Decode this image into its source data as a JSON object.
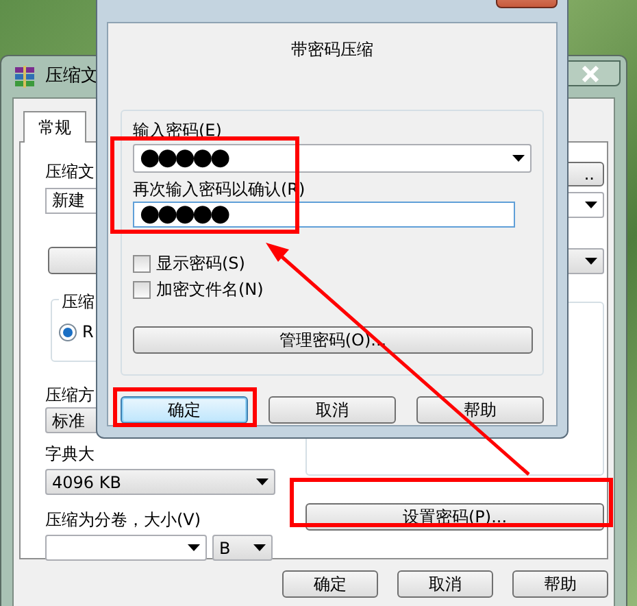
{
  "background_window": {
    "title": "压缩文",
    "tabs": [
      {
        "label": "常规",
        "selected": true
      }
    ],
    "archive_name_label": "压缩文",
    "archive_name": "新建",
    "browse_button": "..",
    "format_group_label": "压缩",
    "format_options": [
      {
        "label": "R",
        "selected": true
      }
    ],
    "method_label": "压缩方",
    "method": "标准",
    "dictionary_label": "字典大",
    "dictionary": "4096 KB",
    "split_label": "压缩为分卷，大小(V)",
    "split_unit": "B",
    "set_password_button": "设置密码(P)...",
    "buttons": [
      "确定",
      "取消",
      "帮助"
    ]
  },
  "dialog": {
    "heading": "带密码压缩",
    "password_label": "输入密码(E)",
    "password": "●●●●●",
    "confirm_label": "再次输入密码以确认(R)",
    "confirm": "●●●●●",
    "options": [
      {
        "label": "显示密码(S)",
        "checked": false
      },
      {
        "label": "加密文件名(N)",
        "checked": false
      }
    ],
    "manage_button": "管理密码(O)...",
    "buttons": [
      {
        "label": "确定",
        "default": true
      },
      {
        "label": "取消",
        "default": false
      },
      {
        "label": "帮助",
        "default": false
      }
    ]
  }
}
